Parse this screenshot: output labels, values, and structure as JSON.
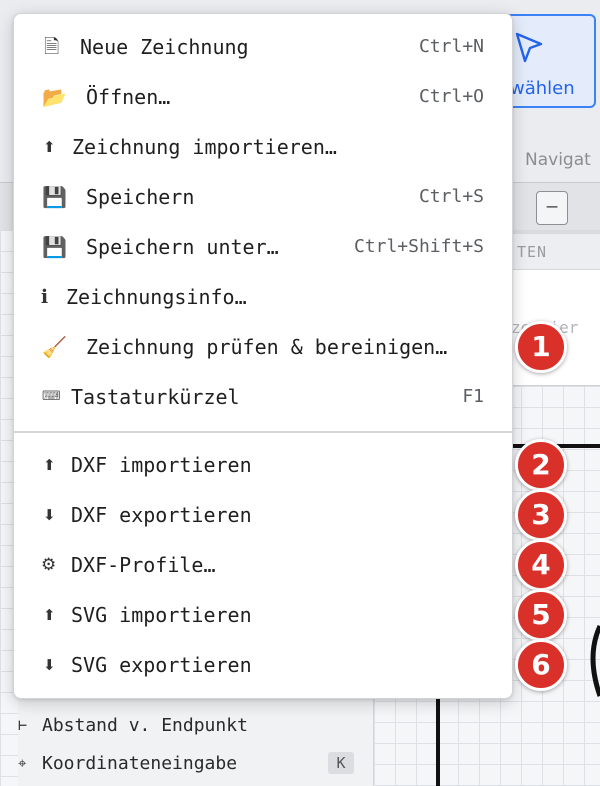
{
  "background": {
    "select_tool_label": "wählen",
    "navigate_tab": "Navigat",
    "collapse_button": "–",
    "panel_header": "TEN",
    "panel_hint": "ze  hier",
    "snap_items": [
      {
        "icon": "⊢",
        "label": "Abstand v. Endpunkt"
      },
      {
        "icon": "⌖",
        "label": "Koordinateneingabe",
        "key": "K"
      }
    ]
  },
  "menu": {
    "items": [
      {
        "icon": "🗎",
        "label": "Neue Zeichnung",
        "shortcut": "Ctrl+N"
      },
      {
        "icon": "📂",
        "label": "Öffnen…",
        "shortcut": "Ctrl+O"
      },
      {
        "icon": "⬆",
        "label": "Zeichnung importieren…",
        "shortcut": ""
      },
      {
        "icon": "💾",
        "label": "Speichern",
        "shortcut": "Ctrl+S"
      },
      {
        "icon": "💾",
        "label": "Speichern unter…",
        "shortcut": "Ctrl+Shift+S"
      },
      {
        "icon": "ℹ",
        "label": "Zeichnungsinfo…",
        "shortcut": ""
      },
      {
        "icon": "🧹",
        "label": "Zeichnung prüfen & bereinigen…",
        "shortcut": ""
      },
      {
        "icon": "⌨",
        "label": "Tastaturkürzel",
        "shortcut": "F1"
      },
      {
        "icon": "⬆",
        "label": "DXF importieren",
        "shortcut": ""
      },
      {
        "icon": "⬇",
        "label": "DXF exportieren",
        "shortcut": ""
      },
      {
        "icon": "⚙",
        "label": "DXF-Profile…",
        "shortcut": ""
      },
      {
        "icon": "⬆",
        "label": "SVG importieren",
        "shortcut": ""
      },
      {
        "icon": "⬇",
        "label": "SVG exportieren",
        "shortcut": ""
      }
    ]
  },
  "callouts": [
    "1",
    "2",
    "3",
    "4",
    "5",
    "6"
  ],
  "colors": {
    "accent": "#3b82f6",
    "callout": "#d9302a"
  }
}
